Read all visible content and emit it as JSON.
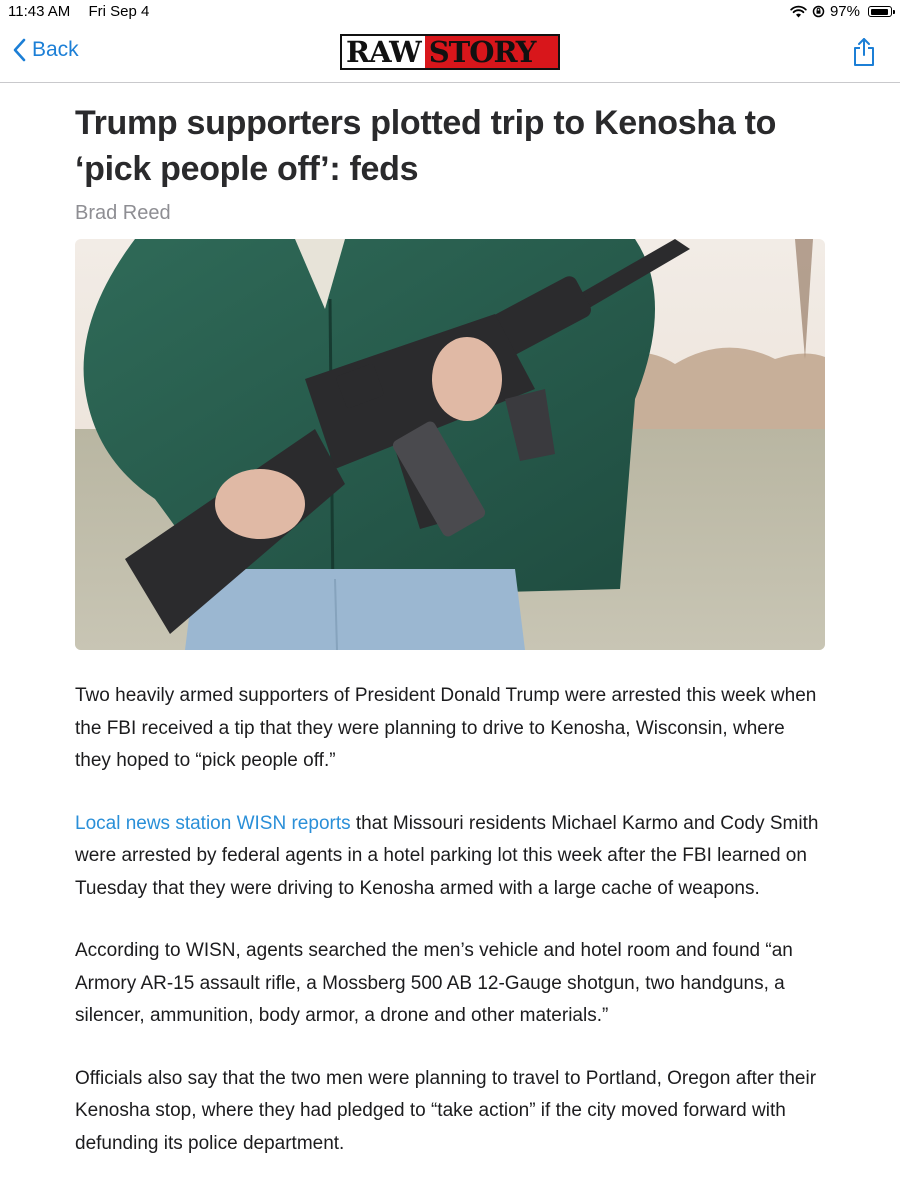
{
  "status_bar": {
    "time": "11:43 AM",
    "date": "Fri Sep 4",
    "battery_text": "97%",
    "battery_level": 0.97
  },
  "nav": {
    "back_label": "Back",
    "logo_raw": "RAW",
    "logo_story": "STORY",
    "accent": "#1c7fd6",
    "logo_red": "#d8161b"
  },
  "article": {
    "headline": "Trump supporters plotted trip to Kenosha to ‘pick people off’: feds",
    "byline": "Brad Reed",
    "p1": "Two heavily armed supporters of President Donald Trump were arrested this week when the FBI received a tip that they were planning to drive to Kenosha, Wisconsin, where they hoped to “pick people off.”",
    "p2_link": "Local news station WISN reports",
    "p2_rest": " that Missouri residents Michael Karmo and Cody Smith were arrested by federal agents in a hotel parking lot this week after the FBI learned on Tuesday that they were driving to Kenosha armed with a large cache of weapons.",
    "p3": "According to WISN, agents searched the men’s vehicle and hotel room and found “an Armory AR-15 assault rifle, a Mossberg 500 AB 12-Gauge shotgun, two handguns, a silencer, ammunition, body armor, a drone and other materials.”",
    "p4": "Officials also say that the two men were planning to travel to Portland, Oregon after their Kenosha stop, where they had pledged to “take action” if the city moved forward with defunding its police department.",
    "link_color": "#2a8fd8"
  }
}
